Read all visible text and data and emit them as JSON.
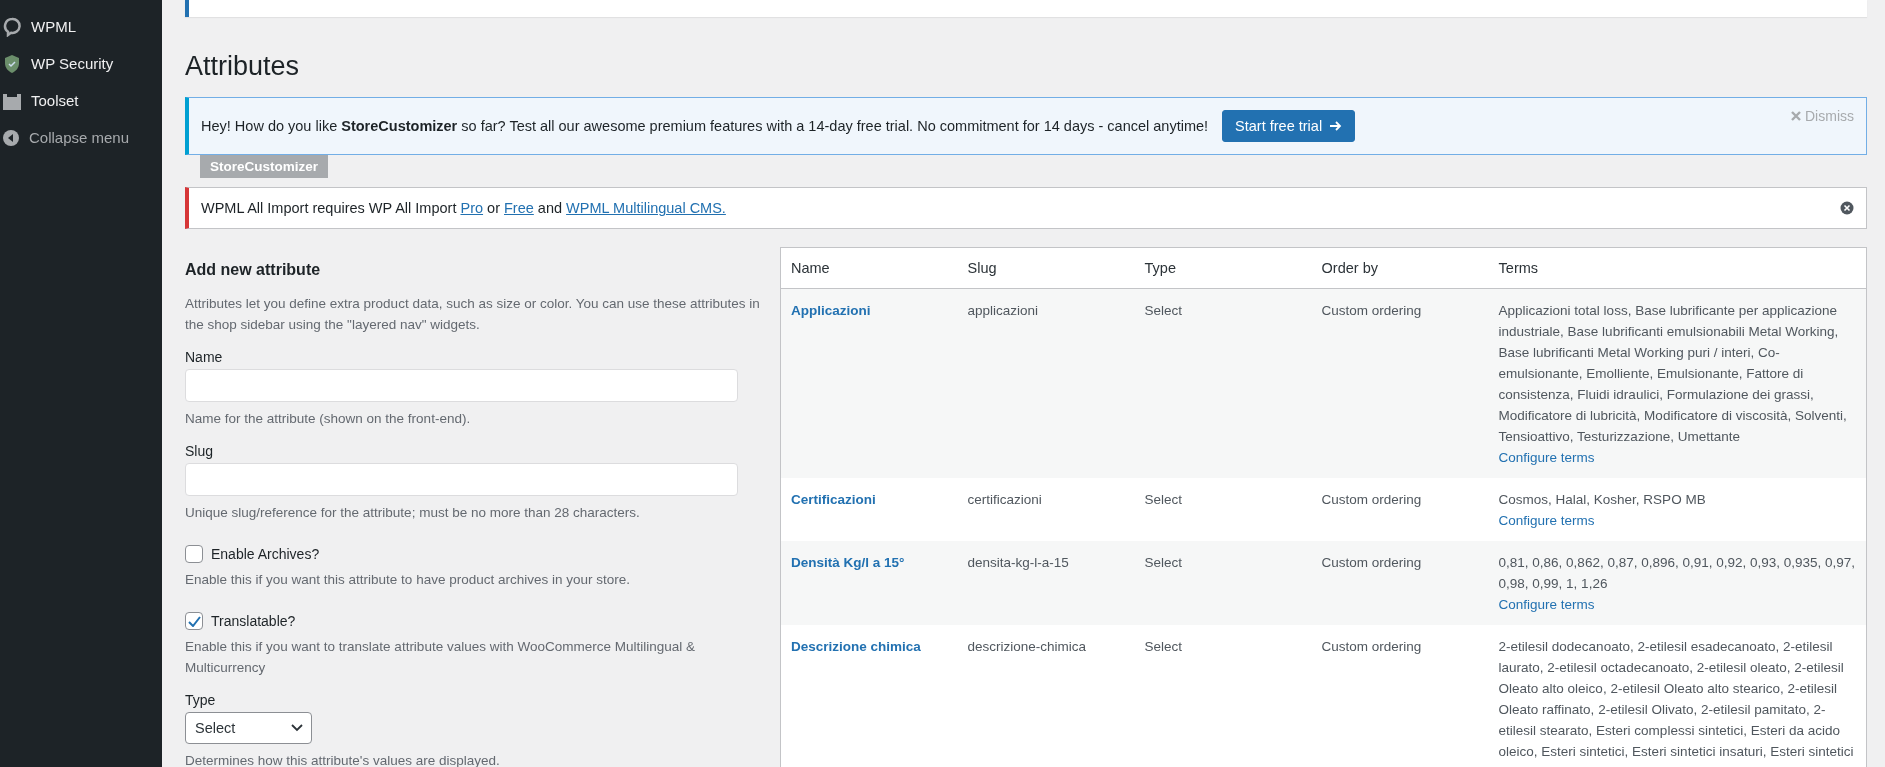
{
  "sidebar": {
    "items": [
      {
        "label": "WPML",
        "kind": "wpml"
      },
      {
        "label": "WP Security",
        "kind": "shield"
      },
      {
        "label": "Toolset",
        "kind": "toolset"
      },
      {
        "label": "Collapse menu",
        "kind": "collapse"
      }
    ]
  },
  "page_title": "Attributes",
  "promo_notice": {
    "text": "Hey! How do you like **StoreCustomizer** so far? Test all our awesome premium features with a 14-day free trial. No commitment for 14 days - cancel anytime!",
    "button": "Start free trial",
    "dismiss": "Dismiss",
    "tag": "StoreCustomizer"
  },
  "error_notice": {
    "parts": [
      {
        "text": "WPML All Import requires WP All Import ",
        "kind": "plain"
      },
      {
        "text": "Pro",
        "kind": "link"
      },
      {
        "text": " or ",
        "kind": "plain"
      },
      {
        "text": "Free",
        "kind": "link"
      },
      {
        "text": " and ",
        "kind": "plain"
      },
      {
        "text": "WPML Multilingual CMS.",
        "kind": "link"
      }
    ]
  },
  "form": {
    "heading": "Add new attribute",
    "intro": "Attributes let you define extra product data, such as size or color. You can use these attributes in the shop sidebar using the \"layered nav\" widgets.",
    "fields": [
      {
        "kind": "text",
        "label": "Name",
        "hint": "Name for the attribute (shown on the front-end)."
      },
      {
        "kind": "text",
        "label": "Slug",
        "hint": "Unique slug/reference for the attribute; must be no more than 28 characters."
      },
      {
        "kind": "checkbox",
        "label": "Enable Archives?",
        "checked": false,
        "hint": "Enable this if you want this attribute to have product archives in your store."
      },
      {
        "kind": "checkbox",
        "label": "Translatable?",
        "checked": true,
        "hint": "Enable this if you want to translate attribute values with WooCommerce Multilingual & Multicurrency"
      },
      {
        "kind": "select",
        "label": "Type",
        "value": "Select",
        "hint": "Determines how this attribute's values are displayed."
      }
    ]
  },
  "table": {
    "columns": [
      "Name",
      "Slug",
      "Type",
      "Order by",
      "Terms"
    ],
    "rows": [
      {
        "name": "Applicazioni",
        "slug": "applicazioni",
        "type": "Select",
        "order_by": "Custom ordering",
        "terms": "Applicazioni total loss, Base lubrificante per applicazione industriale, Base lubrificanti emulsionabili Metal Working, Base lubrificanti Metal Working puri / interi, Co-emulsionante, Emolliente, Emulsionante, Fattore di consistenza, Fluidi idraulici, Formulazione dei grassi, Modificatore di lubricità, Modificatore di viscosità, Solventi, Tensioattivo, Testurizzazione, Umettante",
        "action": "Configure terms"
      },
      {
        "name": "Certificazioni",
        "slug": "certificazioni",
        "type": "Select",
        "order_by": "Custom ordering",
        "terms": "Cosmos, Halal, Kosher, RSPO MB",
        "action": "Configure terms"
      },
      {
        "name": "Densità Kg/l a 15°",
        "slug": "densita-kg-l-a-15",
        "type": "Select",
        "order_by": "Custom ordering",
        "terms": "0,81, 0,86, 0,862, 0,87, 0,896, 0,91, 0,92, 0,93, 0,935, 0,97, 0,98, 0,99, 1, 1,26",
        "action": "Configure terms"
      },
      {
        "name": "Descrizione chimica",
        "slug": "descrizione-chimica",
        "type": "Select",
        "order_by": "Custom ordering",
        "terms": "2-etilesil dodecanoato, 2-etilesil esadecanoato, 2-etilesil laurato, 2-etilesil octadecanoato, 2-etilesil oleato, 2-etilesil Oleato alto oleico, 2-etilesil Oleato alto stearico, 2-etilesil Oleato raffinato, 2-etilesil Olivato, 2-etilesil pamitato, 2-etilesil stearato, Esteri complessi sintetici, Esteri da acido oleico, Esteri sintetici, Esteri sintetici insaturi, Esteri sintetici"
      }
    ]
  }
}
